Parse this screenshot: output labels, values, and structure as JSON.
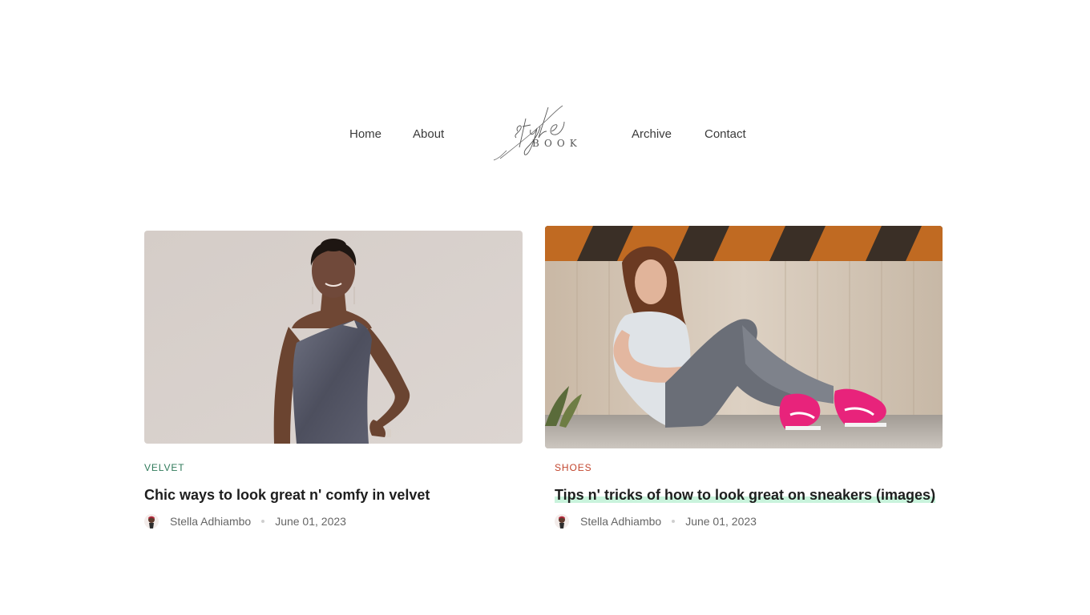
{
  "nav": {
    "left_links": [
      "Home",
      "About"
    ],
    "right_links": [
      "Archive",
      "Contact"
    ],
    "logo": {
      "script": "style",
      "caps": "BOOK"
    }
  },
  "posts": [
    {
      "category": "VELVET",
      "category_color": "#2f7a5a",
      "title": "Chic ways to look great n' comfy in velvet",
      "author": "Stella Adhiambo",
      "date": "June 01, 2023",
      "image": "woman-in-velvet-dress-photo"
    },
    {
      "category": "SHOES",
      "category_color": "#c2452d",
      "title": "Tips n' tricks of how to look great on sneakers (images)",
      "author": "Stella Adhiambo",
      "date": "June 01, 2023",
      "image": "woman-in-pink-sneakers-photo",
      "title_highlight": "#c9f3dc"
    }
  ]
}
